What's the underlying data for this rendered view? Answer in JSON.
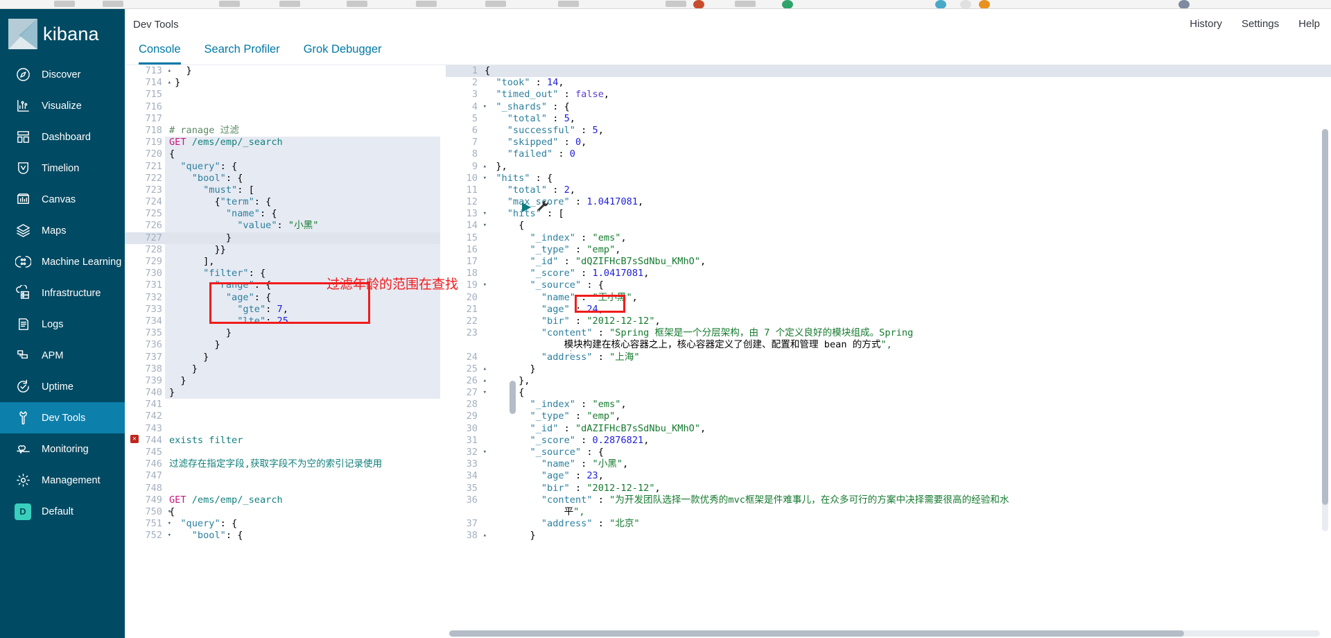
{
  "browser": {
    "tab_count": 10
  },
  "sidebar": {
    "brand": "kibana",
    "items": [
      {
        "label": "Discover",
        "icon": "compass-icon",
        "active": false
      },
      {
        "label": "Visualize",
        "icon": "barchart-icon",
        "active": false
      },
      {
        "label": "Dashboard",
        "icon": "dashboard-icon",
        "active": false
      },
      {
        "label": "Timelion",
        "icon": "timelion-icon",
        "active": false
      },
      {
        "label": "Canvas",
        "icon": "canvas-icon",
        "active": false
      },
      {
        "label": "Maps",
        "icon": "maps-icon",
        "active": false
      },
      {
        "label": "Machine Learning",
        "icon": "ml-icon",
        "active": false
      },
      {
        "label": "Infrastructure",
        "icon": "infra-icon",
        "active": false
      },
      {
        "label": "Logs",
        "icon": "logs-icon",
        "active": false
      },
      {
        "label": "APM",
        "icon": "apm-icon",
        "active": false
      },
      {
        "label": "Uptime",
        "icon": "uptime-icon",
        "active": false
      },
      {
        "label": "Dev Tools",
        "icon": "wrench-icon",
        "active": true
      },
      {
        "label": "Monitoring",
        "icon": "heartbeat-icon",
        "active": false
      },
      {
        "label": "Management",
        "icon": "gear-icon",
        "active": false
      },
      {
        "label": "Default",
        "icon": "space-badge",
        "active": false,
        "badge": "D"
      }
    ],
    "colors": {
      "bg": "#014a63",
      "active": "#0d7fab",
      "badge": "#38d0bd"
    }
  },
  "header": {
    "title": "Dev Tools",
    "links": [
      {
        "label": "History"
      },
      {
        "label": "Settings"
      },
      {
        "label": "Help"
      }
    ]
  },
  "tabs": [
    {
      "label": "Console",
      "active": true
    },
    {
      "label": "Search Profiler",
      "active": false
    },
    {
      "label": "Grok Debugger",
      "active": false
    }
  ],
  "toolbar": {
    "run_label": "play-icon",
    "wrench_label": "wrench-icon"
  },
  "request_editor": {
    "first_line_number": 713,
    "current_line": 727,
    "error_line": 744,
    "lines": [
      {
        "n": 713,
        "fold": "up",
        "text": "   }"
      },
      {
        "n": 714,
        "fold": "up",
        "text": " }"
      },
      {
        "n": 715,
        "fold": "",
        "text": ""
      },
      {
        "n": 716,
        "fold": "",
        "text": ""
      },
      {
        "n": 717,
        "fold": "",
        "text": ""
      },
      {
        "n": 718,
        "fold": "",
        "text": "# ranage 过滤"
      },
      {
        "n": 719,
        "fold": "",
        "text": "GET /ems/emp/_search"
      },
      {
        "n": 720,
        "fold": "down",
        "text": "{"
      },
      {
        "n": 721,
        "fold": "down",
        "text": "  \"query\": {"
      },
      {
        "n": 722,
        "fold": "down",
        "text": "    \"bool\": {"
      },
      {
        "n": 723,
        "fold": "down",
        "text": "      \"must\": ["
      },
      {
        "n": 724,
        "fold": "down",
        "text": "        {\"term\": {"
      },
      {
        "n": 725,
        "fold": "down",
        "text": "          \"name\": {"
      },
      {
        "n": 726,
        "fold": "",
        "text": "            \"value\": \"小黑\""
      },
      {
        "n": 727,
        "fold": "up",
        "text": "          }"
      },
      {
        "n": 728,
        "fold": "up",
        "text": "        }}"
      },
      {
        "n": 729,
        "fold": "up",
        "text": "      ],"
      },
      {
        "n": 730,
        "fold": "down",
        "text": "      \"filter\": {"
      },
      {
        "n": 731,
        "fold": "down",
        "text": "        \"range\": {"
      },
      {
        "n": 732,
        "fold": "down",
        "text": "          \"age\": {"
      },
      {
        "n": 733,
        "fold": "",
        "text": "            \"gte\": 7,"
      },
      {
        "n": 734,
        "fold": "",
        "text": "            \"lte\": 25"
      },
      {
        "n": 735,
        "fold": "up",
        "text": "          }"
      },
      {
        "n": 736,
        "fold": "up",
        "text": "        }"
      },
      {
        "n": 737,
        "fold": "up",
        "text": "      }"
      },
      {
        "n": 738,
        "fold": "up",
        "text": "    }"
      },
      {
        "n": 739,
        "fold": "up",
        "text": "  }"
      },
      {
        "n": 740,
        "fold": "up",
        "text": "}"
      },
      {
        "n": 741,
        "fold": "",
        "text": ""
      },
      {
        "n": 742,
        "fold": "",
        "text": ""
      },
      {
        "n": 743,
        "fold": "",
        "text": ""
      },
      {
        "n": 744,
        "fold": "",
        "text": "exists filter"
      },
      {
        "n": 745,
        "fold": "",
        "text": ""
      },
      {
        "n": 746,
        "fold": "",
        "text": "过滤存在指定字段,获取字段不为空的索引记录使用"
      },
      {
        "n": 747,
        "fold": "",
        "text": ""
      },
      {
        "n": 748,
        "fold": "",
        "text": ""
      },
      {
        "n": 749,
        "fold": "",
        "text": "GET /ems/emp/_search"
      },
      {
        "n": 750,
        "fold": "down",
        "text": "{"
      },
      {
        "n": 751,
        "fold": "down",
        "text": "  \"query\": {"
      },
      {
        "n": 752,
        "fold": "down",
        "text": "    \"bool\": {"
      }
    ]
  },
  "response_editor": {
    "current_line": 1,
    "lines": [
      {
        "n": 1,
        "fold": "down",
        "text": "{"
      },
      {
        "n": 2,
        "fold": "",
        "text": "  \"took\" : 14,"
      },
      {
        "n": 3,
        "fold": "",
        "text": "  \"timed_out\" : false,"
      },
      {
        "n": 4,
        "fold": "down",
        "text": "  \"_shards\" : {"
      },
      {
        "n": 5,
        "fold": "",
        "text": "    \"total\" : 5,"
      },
      {
        "n": 6,
        "fold": "",
        "text": "    \"successful\" : 5,"
      },
      {
        "n": 7,
        "fold": "",
        "text": "    \"skipped\" : 0,"
      },
      {
        "n": 8,
        "fold": "",
        "text": "    \"failed\" : 0"
      },
      {
        "n": 9,
        "fold": "up",
        "text": "  },"
      },
      {
        "n": 10,
        "fold": "down",
        "text": "  \"hits\" : {"
      },
      {
        "n": 11,
        "fold": "",
        "text": "    \"total\" : 2,"
      },
      {
        "n": 12,
        "fold": "",
        "text": "    \"max_score\" : 1.0417081,"
      },
      {
        "n": 13,
        "fold": "down",
        "text": "    \"hits\" : ["
      },
      {
        "n": 14,
        "fold": "down",
        "text": "      {"
      },
      {
        "n": 15,
        "fold": "",
        "text": "        \"_index\" : \"ems\","
      },
      {
        "n": 16,
        "fold": "",
        "text": "        \"_type\" : \"emp\","
      },
      {
        "n": 17,
        "fold": "",
        "text": "        \"_id\" : \"dQZIFHcB7sSdNbu_KMhO\","
      },
      {
        "n": 18,
        "fold": "",
        "text": "        \"_score\" : 1.0417081,"
      },
      {
        "n": 19,
        "fold": "down",
        "text": "        \"_source\" : {"
      },
      {
        "n": 20,
        "fold": "",
        "text": "          \"name\" : \"王小黑\","
      },
      {
        "n": 21,
        "fold": "",
        "text": "          \"age\" : 24,"
      },
      {
        "n": 22,
        "fold": "",
        "text": "          \"bir\" : \"2012-12-12\","
      },
      {
        "n": 23,
        "fold": "",
        "text": "          \"content\" : \"Spring 框架是一个分层架构，由 7 个定义良好的模块组成。Spring"
      },
      {
        "n": "",
        "fold": "",
        "text": "              模块构建在核心容器之上，核心容器定义了创建、配置和管理 bean 的方式\","
      },
      {
        "n": 24,
        "fold": "",
        "text": "          \"address\" : \"上海\""
      },
      {
        "n": 25,
        "fold": "up",
        "text": "        }"
      },
      {
        "n": 26,
        "fold": "up",
        "text": "      },"
      },
      {
        "n": 27,
        "fold": "down",
        "text": "      {"
      },
      {
        "n": 28,
        "fold": "",
        "text": "        \"_index\" : \"ems\","
      },
      {
        "n": 29,
        "fold": "",
        "text": "        \"_type\" : \"emp\","
      },
      {
        "n": 30,
        "fold": "",
        "text": "        \"_id\" : \"dAZIFHcB7sSdNbu_KMhO\","
      },
      {
        "n": 31,
        "fold": "",
        "text": "        \"_score\" : 0.2876821,"
      },
      {
        "n": 32,
        "fold": "down",
        "text": "        \"_source\" : {"
      },
      {
        "n": 33,
        "fold": "",
        "text": "          \"name\" : \"小黑\","
      },
      {
        "n": 34,
        "fold": "",
        "text": "          \"age\" : 23,"
      },
      {
        "n": 35,
        "fold": "",
        "text": "          \"bir\" : \"2012-12-12\","
      },
      {
        "n": 36,
        "fold": "",
        "text": "          \"content\" : \"为开发团队选择一款优秀的mvc框架是件难事儿，在众多可行的方案中决择需要很高的经验和水"
      },
      {
        "n": "",
        "fold": "",
        "text": "              平\","
      },
      {
        "n": 37,
        "fold": "",
        "text": "          \"address\" : \"北京\""
      },
      {
        "n": 38,
        "fold": "up",
        "text": "        }"
      }
    ]
  },
  "annotations": {
    "request_note": "过滤年龄的范围在查找",
    "box_color": "#f01c1c"
  }
}
